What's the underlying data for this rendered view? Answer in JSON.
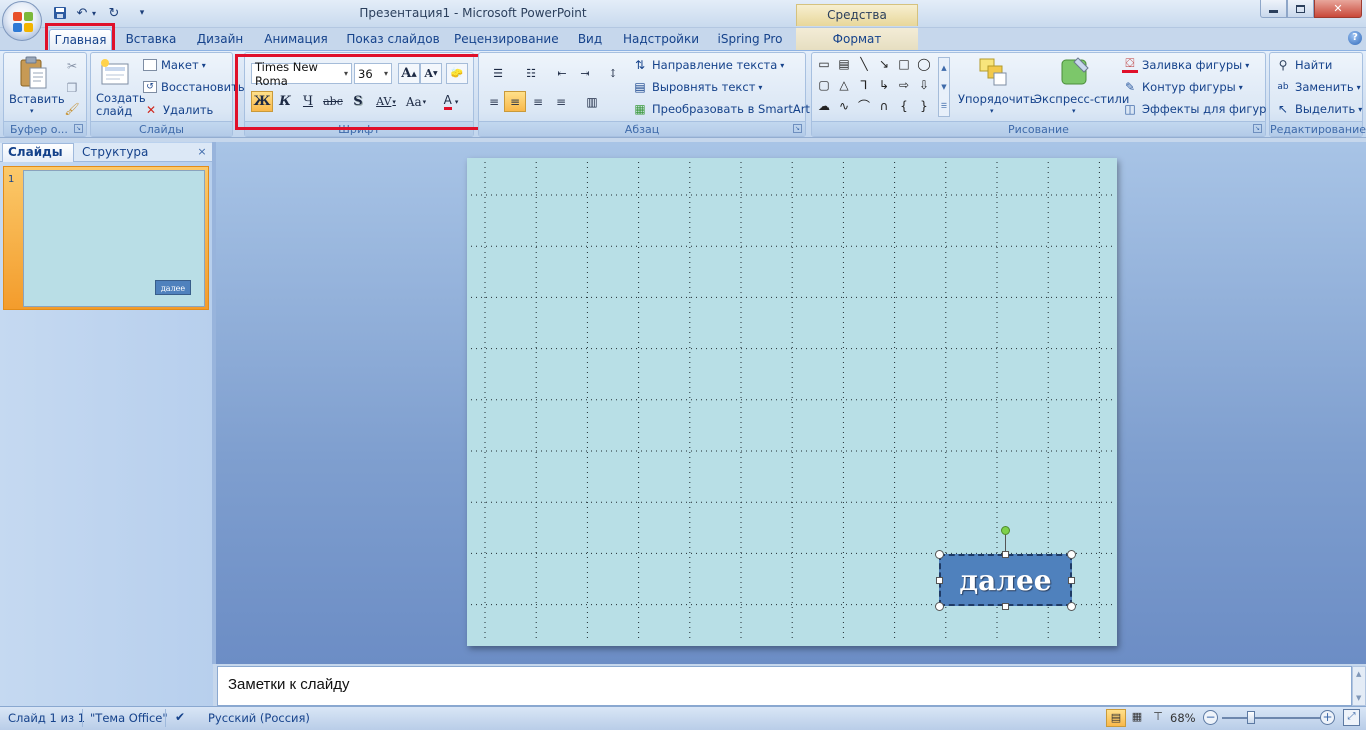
{
  "window": {
    "title": "Презентация1 - Microsoft PowerPoint",
    "context_tab_title": "Средства рисования"
  },
  "tabs": [
    {
      "label": "Главная",
      "active": true
    },
    {
      "label": "Вставка"
    },
    {
      "label": "Дизайн"
    },
    {
      "label": "Анимация"
    },
    {
      "label": "Показ слайдов"
    },
    {
      "label": "Рецензирование"
    },
    {
      "label": "Вид"
    },
    {
      "label": "Надстройки"
    },
    {
      "label": "iSpring Pro"
    },
    {
      "label": "Формат"
    }
  ],
  "ribbon": {
    "clipboard": {
      "paste_label": "Вставить",
      "group_label": "Буфер о..."
    },
    "slides": {
      "new_slide_label": "Создать слайд",
      "layout_label": "Макет",
      "reset_label": "Восстановить",
      "delete_label": "Удалить",
      "group_label": "Слайды"
    },
    "font": {
      "font_name": "Times New Roma",
      "font_size": "36",
      "bold": "Ж",
      "italic": "К",
      "underline": "Ч",
      "strike": "abc",
      "shadow": "S",
      "spacing": "AV",
      "case": "Aa",
      "color": "A",
      "grow": "A",
      "shrink": "A",
      "group_label": "Шрифт"
    },
    "paragraph": {
      "text_direction_label": "Направление текста",
      "align_text_label": "Выровнять текст",
      "smartart_label": "Преобразовать в SmartArt",
      "group_label": "Абзац"
    },
    "drawing": {
      "arrange_label": "Упорядочить",
      "quick_styles_label": "Экспресс-стили",
      "fill_label": "Заливка фигуры",
      "outline_label": "Контур фигуры",
      "effects_label": "Эффекты для фигур",
      "group_label": "Рисование"
    },
    "editing": {
      "find_label": "Найти",
      "replace_label": "Заменить",
      "select_label": "Выделить",
      "group_label": "Редактирование"
    }
  },
  "left_pane": {
    "tab_slides": "Слайды",
    "tab_outline": "Структура",
    "close": "×",
    "slide_number": "1",
    "thumb_button_text": "далее"
  },
  "slide": {
    "button_text": "далее",
    "background_color": "#b8dfe6",
    "button_color": "#4f81bd"
  },
  "notes": {
    "placeholder": "Заметки к слайду"
  },
  "status": {
    "slide_info": "Слайд 1 из 1",
    "theme": "\"Тема Office\"",
    "language": "Русский (Россия)",
    "zoom": "68%"
  },
  "highlights": {
    "color": "#e0102a"
  }
}
